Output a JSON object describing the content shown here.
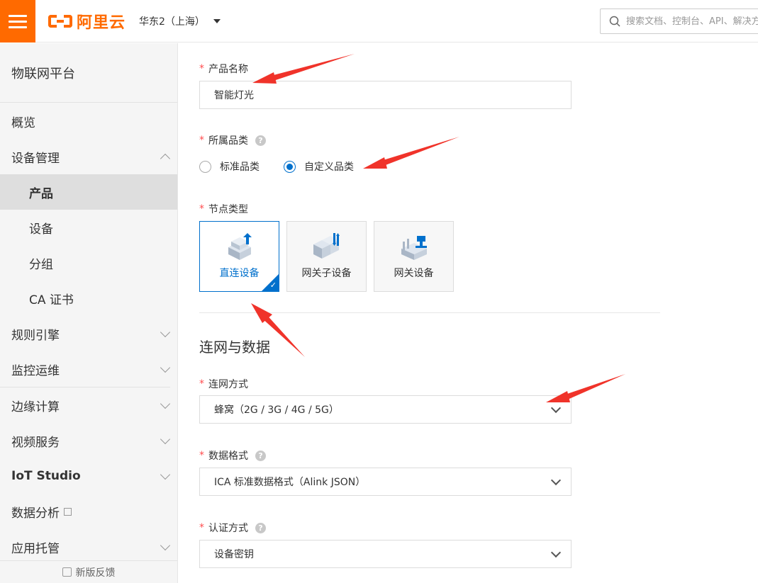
{
  "header": {
    "brand": "阿里云",
    "region": "华东2（上海）",
    "search_placeholder": "搜索文档、控制台、API、解决方案"
  },
  "sidebar": {
    "title": "物联网平台",
    "overview": "概览",
    "device_mgmt": "设备管理",
    "product": "产品",
    "device": "设备",
    "group": "分组",
    "ca": "CA 证书",
    "rules": "规则引擎",
    "monitor": "监控运维",
    "edge": "边缘计算",
    "video": "视频服务",
    "iot_studio": "IoT Studio",
    "analytics": "数据分析",
    "hosting": "应用托管",
    "feedback": "新版反馈"
  },
  "form": {
    "product_name_label": "产品名称",
    "product_name_value": "智能灯光",
    "category_label": "所属品类",
    "category_standard": "标准品类",
    "category_custom": "自定义品类",
    "category_selected": "自定义品类",
    "node_type_label": "节点类型",
    "node_direct": "直连设备",
    "node_sub": "网关子设备",
    "node_gateway": "网关设备",
    "node_selected": "直连设备",
    "section_title": "连网与数据",
    "network_label": "连网方式",
    "network_value": "蜂窝（2G / 3G / 4G / 5G）",
    "data_format_label": "数据格式",
    "data_format_value": "ICA 标准数据格式（Alink JSON）",
    "auth_label": "认证方式",
    "auth_value": "设备密钥",
    "required_mark": "*",
    "help_mark": "?"
  },
  "colors": {
    "brand_orange": "#ff6a00",
    "accent_blue": "#0070cc",
    "annotation_red": "#f0332a"
  }
}
